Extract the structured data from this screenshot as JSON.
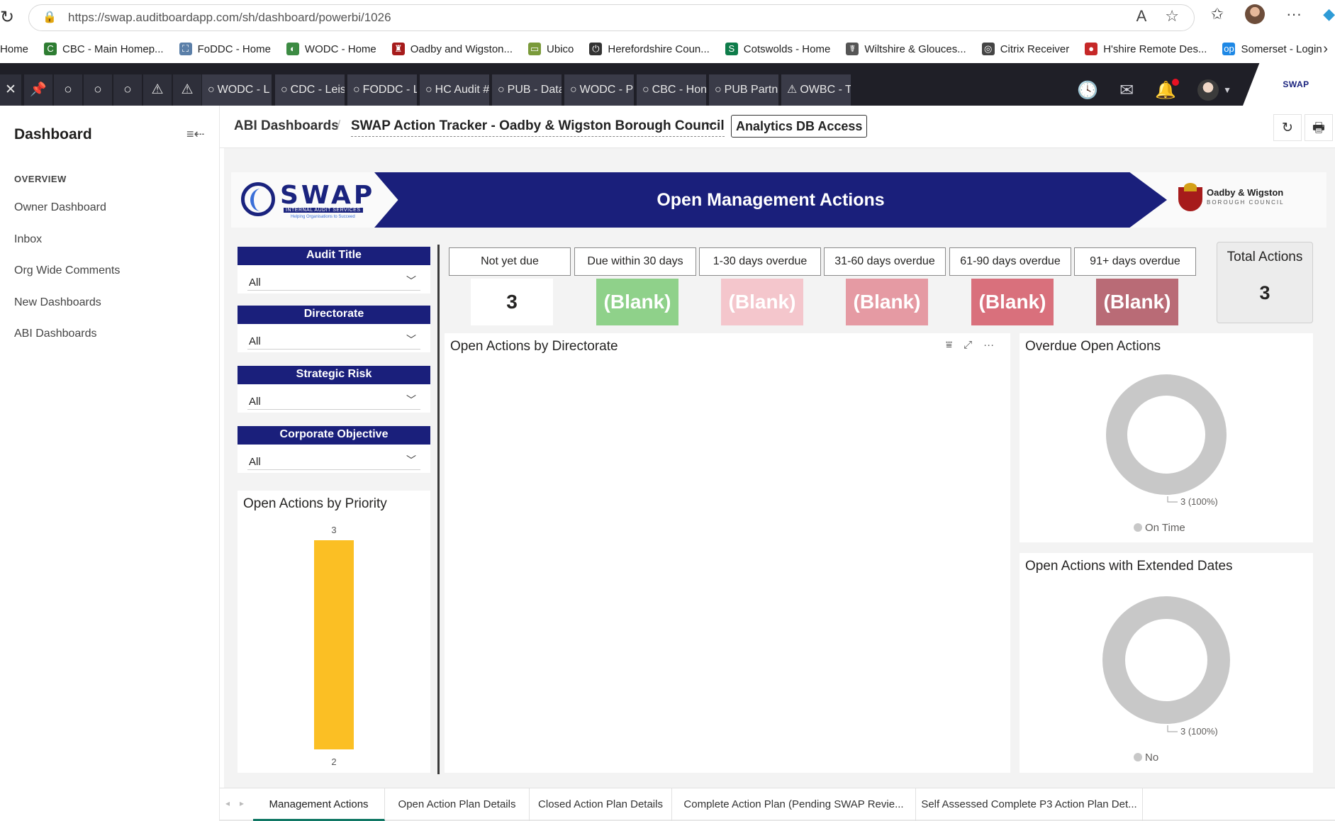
{
  "browser": {
    "url": "https://swap.auditboardapp.com/sh/dashboard/powerbi/1026",
    "bookmarks": [
      {
        "label": "Home",
        "color": ""
      },
      {
        "label": "CBC - Main Homep...",
        "color": "#2e7d32",
        "glyph": "C"
      },
      {
        "label": "FoDDC - Home",
        "color": "#5b7fa8",
        "glyph": "⛶"
      },
      {
        "label": "WODC - Home",
        "color": "#3c8b43",
        "glyph": "◐"
      },
      {
        "label": "Oadby and Wigston...",
        "color": "#a61b1b",
        "glyph": "♜"
      },
      {
        "label": "Ubico",
        "color": "#7a9a3a",
        "glyph": "▭"
      },
      {
        "label": "Herefordshire Coun...",
        "color": "#333333",
        "glyph": "⏻"
      },
      {
        "label": "Cotswolds - Home",
        "color": "#0e7c4a",
        "glyph": "S"
      },
      {
        "label": "Wiltshire & Glouces...",
        "color": "#555555",
        "glyph": "☤"
      },
      {
        "label": "Citrix Receiver",
        "color": "#444444",
        "glyph": "◎"
      },
      {
        "label": "H'shire Remote Des...",
        "color": "#c62828",
        "glyph": "●"
      },
      {
        "label": "Somerset - Login",
        "color": "#1e88e5",
        "glyph": "op"
      }
    ]
  },
  "tabbar": {
    "buttons": [
      "✕",
      "📌",
      "○",
      "○",
      "○",
      "⚠",
      "⚠"
    ],
    "tabs": [
      "WODC - L",
      "CDC - Leis",
      "FODDC - L",
      "HC Audit #",
      "PUB - Data",
      "WODC - P",
      "CBC - Hon",
      "PUB Partn",
      "OWBC - Tr"
    ],
    "tab_icons": [
      "○",
      "○",
      "○",
      "○",
      "○",
      "○",
      "○",
      "○",
      "⚠"
    ],
    "logo": "SWAP"
  },
  "sidebar": {
    "title": "Dashboard",
    "section": "OVERVIEW",
    "items": [
      "Owner Dashboard",
      "Inbox",
      "Org Wide Comments",
      "New Dashboards",
      "ABI Dashboards"
    ]
  },
  "header": {
    "crumb_root": "ABI Dashboards",
    "crumb_current": "SWAP Action Tracker - Oadby & Wigston Borough Council",
    "analytics_button": "Analytics DB Access"
  },
  "report": {
    "banner_title": "Open Management Actions",
    "swap_logo": {
      "word": "SWAP",
      "sub": "INTERNAL AUDIT SERVICES",
      "tag": "Helping Organisations to Succeed"
    },
    "council_logo": {
      "name": "Oadby & Wigston",
      "sub": "BOROUGH COUNCIL"
    },
    "slicers": [
      {
        "label": "Audit Title",
        "value": "All"
      },
      {
        "label": "Directorate",
        "value": "All"
      },
      {
        "label": "Strategic Risk",
        "value": "All"
      },
      {
        "label": "Corporate Objective",
        "value": "All"
      }
    ],
    "kpis": [
      {
        "label": "Not yet due",
        "value": "3",
        "bg": "#ffffff",
        "fg": "#252423"
      },
      {
        "label": "Due within 30 days",
        "value": "(Blank)",
        "bg": "#8fd18a",
        "fg": "#ffffff"
      },
      {
        "label": "1-30 days overdue",
        "value": "(Blank)",
        "bg": "#f4c6cc",
        "fg": "#ffffff"
      },
      {
        "label": "31-60 days overdue",
        "value": "(Blank)",
        "bg": "#e59aa3",
        "fg": "#ffffff"
      },
      {
        "label": "61-90 days overdue",
        "value": "(Blank)",
        "bg": "#d9707c",
        "fg": "#ffffff"
      },
      {
        "label": "91+ days overdue",
        "value": "(Blank)",
        "bg": "#b96b76",
        "fg": "#ffffff"
      }
    ],
    "total": {
      "label": "Total Actions",
      "value": "3"
    },
    "directorate_chart": {
      "title": "Open Actions by Directorate"
    },
    "priority_chart": {
      "title": "Open Actions by Priority",
      "categories": [
        "2"
      ],
      "values": [
        3
      ],
      "color": "#fbbf24"
    },
    "overdue_chart": {
      "title": "Overdue Open Actions",
      "slice_label": "3 (100%)",
      "legend": "On Time",
      "values": [
        3
      ],
      "color": "#c8c8c8"
    },
    "extended_chart": {
      "title": "Open Actions with Extended Dates",
      "slice_label": "3 (100%)",
      "legend": "No",
      "values": [
        3
      ],
      "color": "#c8c8c8"
    }
  },
  "pagetabs": [
    {
      "label": "Management Actions",
      "active": true
    },
    {
      "label": "Open Action Plan Details",
      "active": false
    },
    {
      "label": "Closed Action Plan Details",
      "active": false
    },
    {
      "label": "Complete Action Plan (Pending SWAP Revie...",
      "active": false
    },
    {
      "label": "Self Assessed Complete P3 Action Plan Det...",
      "active": false
    }
  ]
}
